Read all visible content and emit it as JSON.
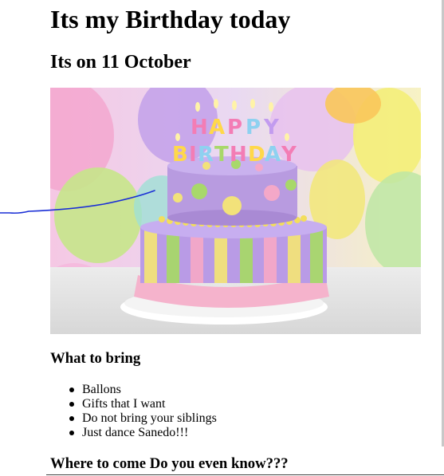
{
  "header": {
    "title": "Its my Birthday today",
    "subtitle": "Its on 11 October"
  },
  "image": {
    "icon": "birthday-cake-image",
    "candle_letters_top": "HAPPY",
    "candle_letters_bottom": "BIRTHDAY"
  },
  "bring_section": {
    "heading": "What to bring",
    "items": [
      "Ballons",
      "Gifts that I want",
      "Do not bring your siblings",
      "Just dance Sanedo!!!"
    ]
  },
  "where_section": {
    "heading": "Where to come Do you even know???"
  },
  "colors": {
    "pen_stroke": "#1a2fd6",
    "cake_purple": "#b89be0",
    "cake_pink": "#f4a8c8",
    "cake_yellow": "#f2e27a",
    "cake_green": "#a8d86a"
  }
}
